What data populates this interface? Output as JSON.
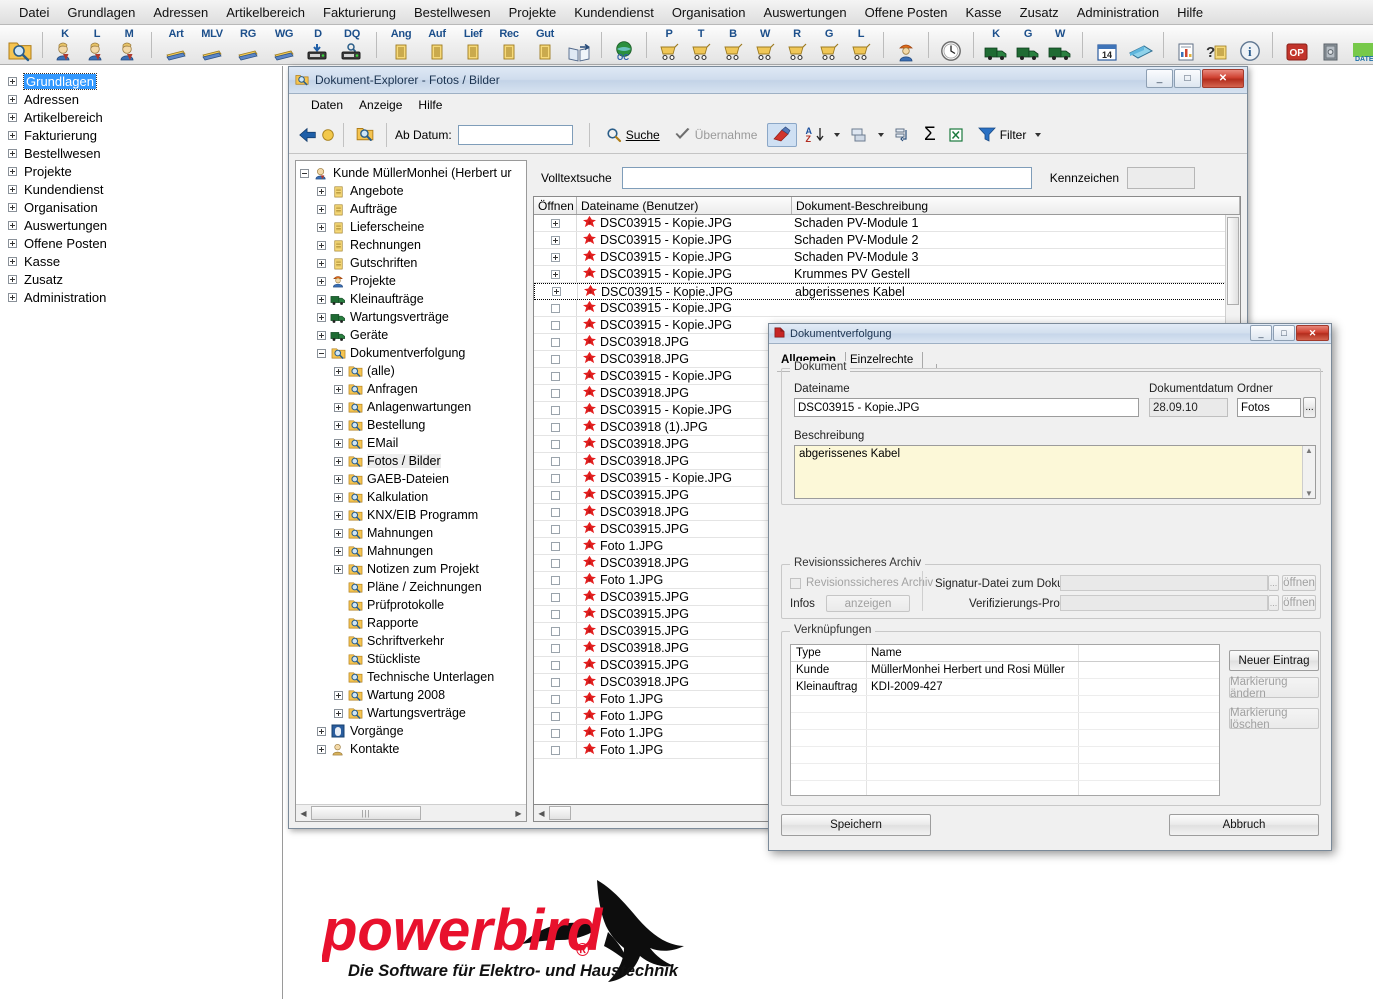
{
  "menubar": {
    "items": [
      "Datei",
      "Grundlagen",
      "Adressen",
      "Artikelbereich",
      "Fakturierung",
      "Bestellwesen",
      "Projekte",
      "Kundendienst",
      "Organisation",
      "Auswertungen",
      "Offene Posten",
      "Kasse",
      "Zusatz",
      "Administration",
      "Hilfe"
    ]
  },
  "toolbar": {
    "groups": [
      {
        "items": [
          {
            "name": "document-search-icon",
            "label": ""
          }
        ]
      },
      {
        "items": [
          {
            "name": "customer-icon",
            "label": "K"
          },
          {
            "name": "supplier-icon",
            "label": "L"
          },
          {
            "name": "employee-icon",
            "label": "M"
          }
        ]
      },
      {
        "items": [
          {
            "name": "article-icon",
            "label": "Art"
          },
          {
            "name": "mlv-icon",
            "label": "MLV"
          },
          {
            "name": "rg-icon",
            "label": "RG"
          },
          {
            "name": "wg-icon",
            "label": "WG"
          },
          {
            "name": "d-download-icon",
            "label": "D"
          },
          {
            "name": "d-search-icon",
            "label": "DQ"
          }
        ]
      },
      {
        "items": [
          {
            "name": "angebot-icon",
            "label": "Ang"
          },
          {
            "name": "auftrag-icon",
            "label": "Auf"
          },
          {
            "name": "lieferschein-icon",
            "label": "Lief"
          },
          {
            "name": "rechnung-icon",
            "label": "Rec"
          },
          {
            "name": "gutschrift-icon",
            "label": "Gut"
          },
          {
            "name": "book-export-icon",
            "label": ""
          }
        ]
      },
      {
        "items": [
          {
            "name": "globe-ocr-icon",
            "label": ""
          }
        ]
      },
      {
        "items": [
          {
            "name": "cart-p-icon",
            "label": "P"
          },
          {
            "name": "cart-t-icon",
            "label": "T"
          },
          {
            "name": "cart-b-icon",
            "label": "B"
          },
          {
            "name": "cart-w-icon",
            "label": "W"
          },
          {
            "name": "cart-r-icon",
            "label": "R"
          },
          {
            "name": "cart-g-icon",
            "label": "G"
          },
          {
            "name": "cart-l-icon",
            "label": "L"
          }
        ]
      },
      {
        "items": [
          {
            "name": "worker-icon",
            "label": ""
          }
        ]
      },
      {
        "items": [
          {
            "name": "clock-icon",
            "label": ""
          }
        ]
      },
      {
        "items": [
          {
            "name": "truck-k-icon",
            "label": "K"
          },
          {
            "name": "truck-g-icon",
            "label": "G"
          },
          {
            "name": "truck-w-icon",
            "label": "W"
          }
        ]
      },
      {
        "items": [
          {
            "name": "calendar-icon",
            "label": "14"
          },
          {
            "name": "scanner-icon",
            "label": ""
          }
        ]
      },
      {
        "items": [
          {
            "name": "report-icon",
            "label": ""
          },
          {
            "name": "help-list-icon",
            "label": ""
          },
          {
            "name": "info-icon",
            "label": ""
          }
        ]
      },
      {
        "items": [
          {
            "name": "op-icon",
            "label": "OP"
          },
          {
            "name": "safe-icon",
            "label": ""
          },
          {
            "name": "datev-icon",
            "label": "DATEV"
          }
        ]
      },
      {
        "items": [
          {
            "name": "archive-icon",
            "label": ""
          },
          {
            "name": "archive-new-icon",
            "label": ""
          }
        ]
      }
    ]
  },
  "leftnav": {
    "items": [
      {
        "label": "Grundlagen",
        "selected": true
      },
      {
        "label": "Adressen",
        "selected": false
      },
      {
        "label": "Artikelbereich",
        "selected": false
      },
      {
        "label": "Fakturierung",
        "selected": false
      },
      {
        "label": "Bestellwesen",
        "selected": false
      },
      {
        "label": "Projekte",
        "selected": false
      },
      {
        "label": "Kundendienst",
        "selected": false
      },
      {
        "label": "Organisation",
        "selected": false
      },
      {
        "label": "Auswertungen",
        "selected": false
      },
      {
        "label": "Offene Posten",
        "selected": false
      },
      {
        "label": "Kasse",
        "selected": false
      },
      {
        "label": "Zusatz",
        "selected": false
      },
      {
        "label": "Administration",
        "selected": false
      }
    ]
  },
  "explorer": {
    "title": "Dokument-Explorer - Fotos / Bilder",
    "menu": [
      "Daten",
      "Anzeige",
      "Hilfe"
    ],
    "tools": {
      "back_label": "",
      "search_view_label": "",
      "ab_datum_label": "Ab Datum:",
      "ab_datum_value": "",
      "suche_label": "Suche",
      "uebernahme_label": "Übernahme",
      "eraser_label": "",
      "sort_az_label": "",
      "group_label": "",
      "layout_label": "",
      "sum_label": "",
      "excel_label": "",
      "filter_label": "Filter"
    },
    "fulltext": {
      "label": "Volltextsuche",
      "value": ""
    },
    "kennzeichen": {
      "label": "Kennzeichen",
      "value": ""
    },
    "tree": [
      {
        "label": "Kunde MüllerMonhei (Herbert ur",
        "depth": 0,
        "exp": "minus",
        "icon": "customer-icon",
        "hl": false
      },
      {
        "label": "Angebote",
        "depth": 1,
        "exp": "plus",
        "icon": "angebot-icon",
        "hl": false
      },
      {
        "label": "Aufträge",
        "depth": 1,
        "exp": "plus",
        "icon": "auftrag-icon",
        "hl": false
      },
      {
        "label": "Lieferscheine",
        "depth": 1,
        "exp": "plus",
        "icon": "lieferschein-icon",
        "hl": false
      },
      {
        "label": "Rechnungen",
        "depth": 1,
        "exp": "plus",
        "icon": "rechnung-icon",
        "hl": false
      },
      {
        "label": "Gutschriften",
        "depth": 1,
        "exp": "plus",
        "icon": "gutschrift-icon",
        "hl": false
      },
      {
        "label": "Projekte",
        "depth": 1,
        "exp": "plus",
        "icon": "worker-icon",
        "hl": false
      },
      {
        "label": "Kleinaufträge",
        "depth": 1,
        "exp": "plus",
        "icon": "truck-icon",
        "hl": false
      },
      {
        "label": "Wartungsverträge",
        "depth": 1,
        "exp": "plus",
        "icon": "truck-icon",
        "hl": false
      },
      {
        "label": "Geräte",
        "depth": 1,
        "exp": "plus",
        "icon": "truck-icon",
        "hl": false
      },
      {
        "label": "Dokumentverfolgung",
        "depth": 1,
        "exp": "minus",
        "icon": "doc-search-icon",
        "hl": false
      },
      {
        "label": "(alle)",
        "depth": 2,
        "exp": "plus",
        "icon": "doc-search-icon",
        "hl": false
      },
      {
        "label": "Anfragen",
        "depth": 2,
        "exp": "plus",
        "icon": "doc-search-icon",
        "hl": false
      },
      {
        "label": "Anlagenwartungen",
        "depth": 2,
        "exp": "plus",
        "icon": "doc-search-icon",
        "hl": false
      },
      {
        "label": "Bestellung",
        "depth": 2,
        "exp": "plus",
        "icon": "doc-search-icon",
        "hl": false
      },
      {
        "label": "EMail",
        "depth": 2,
        "exp": "plus",
        "icon": "doc-search-icon",
        "hl": false
      },
      {
        "label": "Fotos / Bilder",
        "depth": 2,
        "exp": "plus",
        "icon": "doc-search-icon",
        "hl": true
      },
      {
        "label": "GAEB-Dateien",
        "depth": 2,
        "exp": "plus",
        "icon": "doc-search-icon",
        "hl": false
      },
      {
        "label": "Kalkulation",
        "depth": 2,
        "exp": "plus",
        "icon": "doc-search-icon",
        "hl": false
      },
      {
        "label": "KNX/EIB Programm",
        "depth": 2,
        "exp": "plus",
        "icon": "doc-search-icon",
        "hl": false
      },
      {
        "label": "Mahnungen",
        "depth": 2,
        "exp": "plus",
        "icon": "doc-search-icon",
        "hl": false
      },
      {
        "label": "Mahnungen",
        "depth": 2,
        "exp": "plus",
        "icon": "doc-search-icon",
        "hl": false
      },
      {
        "label": "Notizen zum Projekt",
        "depth": 2,
        "exp": "plus",
        "icon": "doc-search-icon",
        "hl": false
      },
      {
        "label": "Pläne / Zeichnungen",
        "depth": 2,
        "exp": "none",
        "icon": "doc-search-icon",
        "hl": false
      },
      {
        "label": "Prüfprotokolle",
        "depth": 2,
        "exp": "none",
        "icon": "doc-search-icon",
        "hl": false
      },
      {
        "label": "Rapporte",
        "depth": 2,
        "exp": "none",
        "icon": "doc-search-icon",
        "hl": false
      },
      {
        "label": "Schriftverkehr",
        "depth": 2,
        "exp": "none",
        "icon": "doc-search-icon",
        "hl": false
      },
      {
        "label": "Stückliste",
        "depth": 2,
        "exp": "none",
        "icon": "doc-search-icon",
        "hl": false
      },
      {
        "label": "Technische Unterlagen",
        "depth": 2,
        "exp": "none",
        "icon": "doc-search-icon",
        "hl": false
      },
      {
        "label": "Wartung 2008",
        "depth": 2,
        "exp": "plus",
        "icon": "doc-search-icon",
        "hl": false
      },
      {
        "label": "Wartungsverträge",
        "depth": 2,
        "exp": "plus",
        "icon": "doc-search-icon",
        "hl": false
      },
      {
        "label": "Vorgänge",
        "depth": 1,
        "exp": "plus",
        "icon": "vorgang-icon",
        "hl": false
      },
      {
        "label": "Kontakte",
        "depth": 1,
        "exp": "plus",
        "icon": "kontakt-icon",
        "hl": false
      }
    ],
    "grid": {
      "columns": [
        "Öffnen",
        "Dateiname (Benutzer)",
        "Dokument-Beschreibung"
      ],
      "rows": [
        {
          "open": "plus",
          "file": "DSC03915 - Kopie.JPG",
          "desc": "Schaden PV-Module 1",
          "current": false
        },
        {
          "open": "plus",
          "file": "DSC03915 - Kopie.JPG",
          "desc": "Schaden PV-Module 2",
          "current": false
        },
        {
          "open": "plus",
          "file": "DSC03915 - Kopie.JPG",
          "desc": "Schaden PV-Module 3",
          "current": false
        },
        {
          "open": "plus",
          "file": "DSC03915 - Kopie.JPG",
          "desc": "Krummes PV Gestell",
          "current": false
        },
        {
          "open": "plus",
          "file": "DSC03915 - Kopie.JPG",
          "desc": "abgerissenes Kabel",
          "current": true
        },
        {
          "open": "empty",
          "file": "DSC03915 - Kopie.JPG",
          "desc": "",
          "current": false
        },
        {
          "open": "empty",
          "file": "DSC03915 - Kopie.JPG",
          "desc": "",
          "current": false
        },
        {
          "open": "empty",
          "file": "DSC03918.JPG",
          "desc": "",
          "current": false
        },
        {
          "open": "empty",
          "file": "DSC03918.JPG",
          "desc": "",
          "current": false
        },
        {
          "open": "empty",
          "file": "DSC03915 - Kopie.JPG",
          "desc": "",
          "current": false
        },
        {
          "open": "empty",
          "file": "DSC03918.JPG",
          "desc": "",
          "current": false
        },
        {
          "open": "empty",
          "file": "DSC03915 - Kopie.JPG",
          "desc": "",
          "current": false
        },
        {
          "open": "empty",
          "file": "DSC03918 (1).JPG",
          "desc": "",
          "current": false
        },
        {
          "open": "empty",
          "file": "DSC03918.JPG",
          "desc": "",
          "current": false
        },
        {
          "open": "empty",
          "file": "DSC03918.JPG",
          "desc": "",
          "current": false
        },
        {
          "open": "empty",
          "file": "DSC03915 - Kopie.JPG",
          "desc": "",
          "current": false
        },
        {
          "open": "empty",
          "file": "DSC03915.JPG",
          "desc": "",
          "current": false
        },
        {
          "open": "empty",
          "file": "DSC03918.JPG",
          "desc": "",
          "current": false
        },
        {
          "open": "empty",
          "file": "DSC03915.JPG",
          "desc": "",
          "current": false
        },
        {
          "open": "empty",
          "file": "Foto 1.JPG",
          "desc": "",
          "current": false
        },
        {
          "open": "empty",
          "file": "DSC03918.JPG",
          "desc": "",
          "current": false
        },
        {
          "open": "empty",
          "file": "Foto 1.JPG",
          "desc": "",
          "current": false
        },
        {
          "open": "empty",
          "file": "DSC03915.JPG",
          "desc": "",
          "current": false
        },
        {
          "open": "empty",
          "file": "DSC03915.JPG",
          "desc": "",
          "current": false
        },
        {
          "open": "empty",
          "file": "DSC03915.JPG",
          "desc": "",
          "current": false
        },
        {
          "open": "empty",
          "file": "DSC03918.JPG",
          "desc": "",
          "current": false
        },
        {
          "open": "empty",
          "file": "DSC03915.JPG",
          "desc": "",
          "current": false
        },
        {
          "open": "empty",
          "file": "DSC03918.JPG",
          "desc": "",
          "current": false
        },
        {
          "open": "empty",
          "file": "Foto 1.JPG",
          "desc": "",
          "current": false
        },
        {
          "open": "empty",
          "file": "Foto 1.JPG",
          "desc": "",
          "current": false
        },
        {
          "open": "empty",
          "file": "Foto 1.JPG",
          "desc": "",
          "current": false
        },
        {
          "open": "empty",
          "file": "Foto 1.JPG",
          "desc": "",
          "current": false
        }
      ]
    }
  },
  "dialog": {
    "title": "Dokumentverfolgung",
    "tabs": [
      {
        "label": "Allgemein",
        "active": true
      },
      {
        "label": "Einzelrechte",
        "active": false
      }
    ],
    "dokument": {
      "caption": "Dokument",
      "dateiname_label": "Dateiname",
      "dateiname_value": "DSC03915 - Kopie.JPG",
      "datum_label": "Dokumentdatum",
      "datum_value": "28.09.10",
      "ordner_label": "Ordner",
      "ordner_value": "Fotos",
      "browse_label": "...",
      "beschreibung_label": "Beschreibung",
      "beschreibung_value": "abgerissenes Kabel"
    },
    "archiv": {
      "caption": "Revisionssicheres Archiv",
      "checkbox_label": "Revisionssicheres Archiv",
      "checkbox_checked": false,
      "infos_label": "Infos",
      "anzeigen_label": "anzeigen",
      "signatur_label": "Signatur-Datei zum Dokument",
      "signatur_value": "",
      "verifizierung_label": "Verifizierungs-Protokoll",
      "verifizierung_value": "",
      "oeffnen_label_1": "öffnen",
      "oeffnen_label_2": "öffnen",
      "browse_label_1": "...",
      "browse_label_2": "..."
    },
    "verknuepfungen": {
      "caption": "Verknüpfungen",
      "columns": [
        "Type",
        "Name"
      ],
      "rows": [
        {
          "type": "Kunde",
          "name": "MüllerMonhei Herbert und Rosi Müller"
        },
        {
          "type": "Kleinauftrag",
          "name": "KDI-2009-427"
        }
      ],
      "buttons": [
        {
          "label": "Neuer Eintrag",
          "disabled": false
        },
        {
          "label": "Markierung ändern",
          "disabled": true
        },
        {
          "label": "Markierung löschen",
          "disabled": true
        }
      ]
    },
    "footer": {
      "save_label": "Speichern",
      "cancel_label": "Abbruch"
    }
  },
  "logo": {
    "brand": "powerbird",
    "registered": "®",
    "tagline": "Die Software für Elektro- und Haustechnik",
    "brand_color": "#e8112d"
  }
}
